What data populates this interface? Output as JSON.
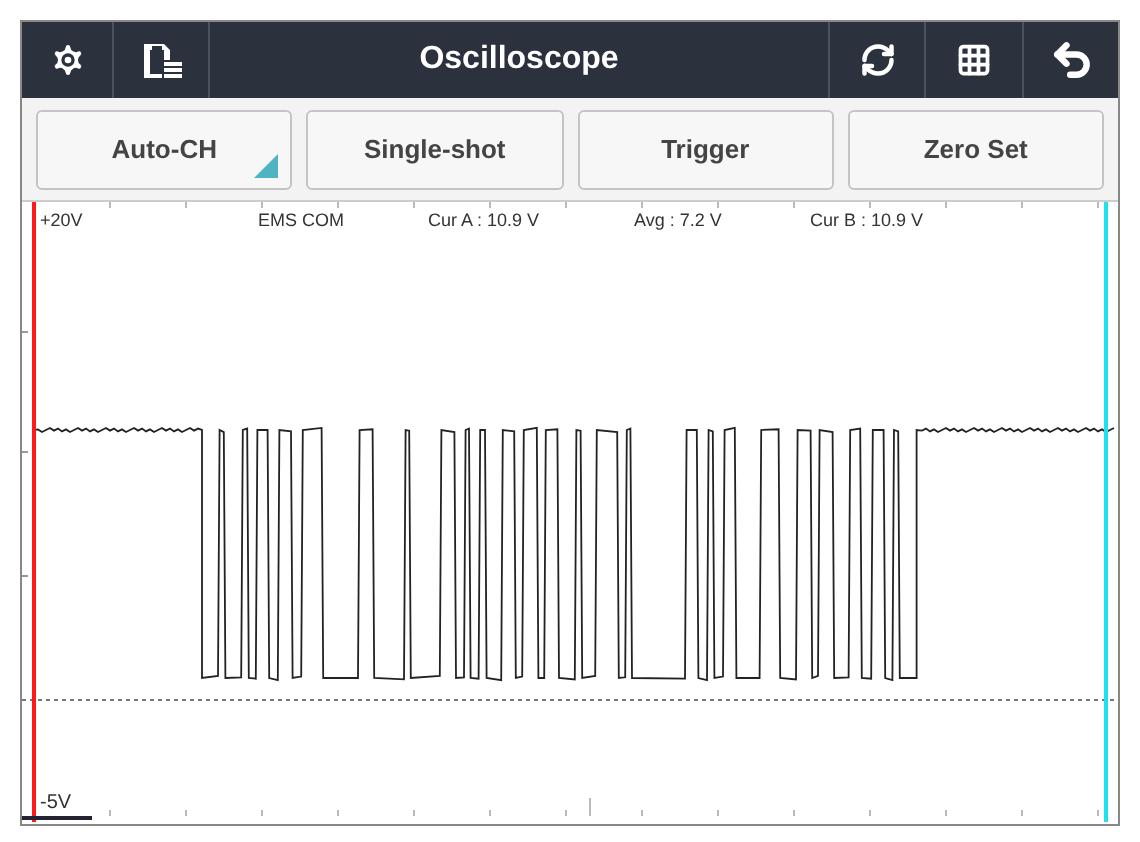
{
  "window": {
    "title": "Oscilloscope"
  },
  "buttons": [
    {
      "label": "Auto-CH",
      "kind": "dropdown"
    },
    {
      "label": "Single-shot",
      "kind": "plain"
    },
    {
      "label": "Trigger",
      "kind": "plain"
    },
    {
      "label": "Zero Set",
      "kind": "plain"
    }
  ],
  "scope": {
    "top_label": "+20V",
    "bottom_label": "-5V",
    "readings": [
      "EMS COM",
      "Cur A : 10.9 V",
      "Avg : 7.2 V",
      "Cur B : 10.9 V"
    ]
  }
}
